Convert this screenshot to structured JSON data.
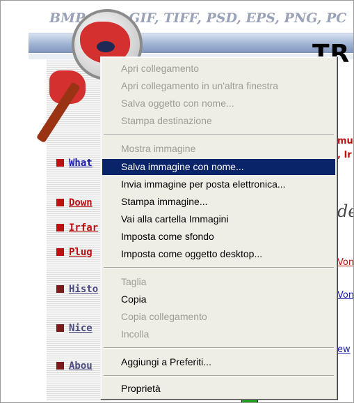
{
  "background": {
    "formats_text": "BMP, JPG, GIF, TIFF, PSD, EPS, PNG, PC",
    "brand_text": "TR",
    "nav": [
      {
        "label": "What",
        "color": "#1a1ab0"
      },
      {
        "label": "Down",
        "color": "#bb1111"
      },
      {
        "label": "Irfar",
        "color": "#bb1111"
      },
      {
        "label": "Plug",
        "color": "#bb1111"
      },
      {
        "label": "Histo",
        "color": "#4a4a80"
      },
      {
        "label": "Nice",
        "color": "#4a4a80"
      },
      {
        "label": "Abou",
        "color": "#4a4a80"
      }
    ],
    "right_fragments": [
      {
        "text": "mu",
        "color": "#bb1111"
      },
      {
        "text": ", Ir",
        "color": "#bb1111"
      },
      {
        "text": "de",
        "color": "#444444"
      },
      {
        "text": "Von",
        "color": "#bb1111"
      },
      {
        "text": "Von",
        "color": "#1a1ab0"
      },
      {
        "text": "ew",
        "color": "#1a1ab0"
      }
    ]
  },
  "context_menu": {
    "items": [
      {
        "label": "Apri collegamento",
        "enabled": false
      },
      {
        "label": "Apri collegamento in un'altra finestra",
        "enabled": false
      },
      {
        "label": "Salva oggetto con nome...",
        "enabled": false
      },
      {
        "label": "Stampa destinazione",
        "enabled": false
      },
      {
        "label": "Mostra immagine",
        "enabled": false
      },
      {
        "label": "Salva immagine con nome...",
        "enabled": true,
        "selected": true
      },
      {
        "label": "Invia immagine per posta elettronica...",
        "enabled": true
      },
      {
        "label": "Stampa immagine...",
        "enabled": true
      },
      {
        "label": "Vai alla cartella Immagini",
        "enabled": true
      },
      {
        "label": "Imposta come sfondo",
        "enabled": true
      },
      {
        "label": "Imposta come oggetto desktop...",
        "enabled": true
      },
      {
        "label": "Taglia",
        "enabled": false
      },
      {
        "label": "Copia",
        "enabled": true
      },
      {
        "label": "Copia collegamento",
        "enabled": false
      },
      {
        "label": "Incolla",
        "enabled": false
      },
      {
        "label": "Aggiungi a Preferiti...",
        "enabled": true
      },
      {
        "label": "Proprietà",
        "enabled": true
      }
    ],
    "colors": {
      "highlight": "#0a246a",
      "disabled_text": "#9c9b94",
      "menu_bg": "#efeee6"
    }
  }
}
